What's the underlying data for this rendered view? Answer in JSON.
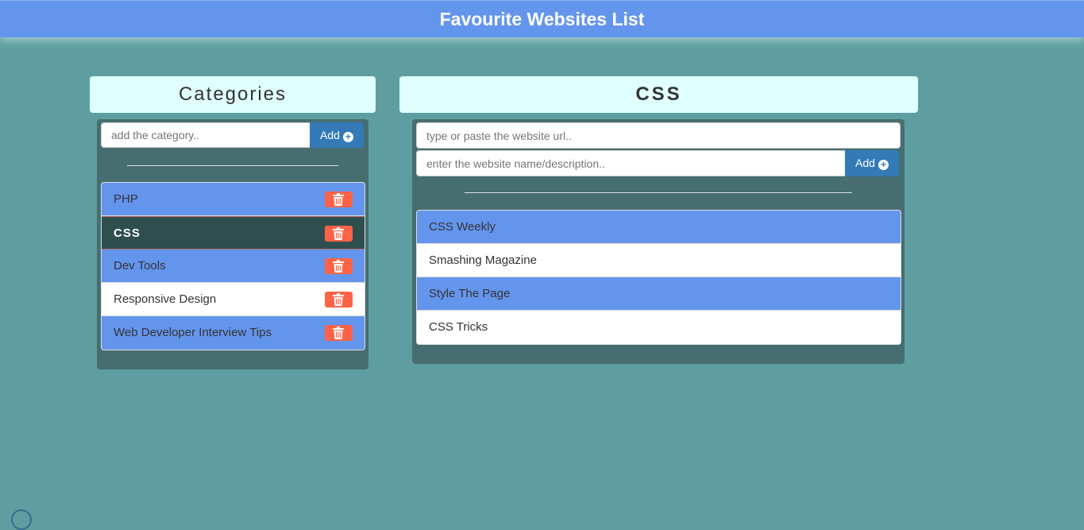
{
  "header": {
    "title": "Favourite Websites List"
  },
  "categories": {
    "title": "Categories",
    "input_placeholder": "add the category..",
    "add_label": "Add",
    "items": [
      {
        "label": "PHP",
        "style": "blue"
      },
      {
        "label": "CSS",
        "style": "active"
      },
      {
        "label": "Dev Tools",
        "style": "blue"
      },
      {
        "label": "Responsive Design",
        "style": "white"
      },
      {
        "label": "Web Developer Interview Tips",
        "style": "blue"
      }
    ]
  },
  "websites": {
    "title": "CSS",
    "url_placeholder": "type or paste the website url..",
    "desc_placeholder": "enter the website name/description..",
    "add_label": "Add",
    "items": [
      {
        "label": "CSS Weekly",
        "style": "blue"
      },
      {
        "label": "Smashing Magazine",
        "style": "white"
      },
      {
        "label": "Style The Page",
        "style": "blue"
      },
      {
        "label": "CSS Tricks",
        "style": "white"
      }
    ]
  },
  "colors": {
    "background": "#5f9ea0",
    "header": "#6495ed",
    "panel_title": "#e0ffff",
    "panel_body": "#466e70",
    "item_blue": "#6495ed",
    "item_active": "#2f4f4f",
    "delete_button": "#ff6347",
    "add_button": "#337ab7"
  },
  "icons": {
    "delete": "trash-icon",
    "add": "plus-circle-icon"
  }
}
